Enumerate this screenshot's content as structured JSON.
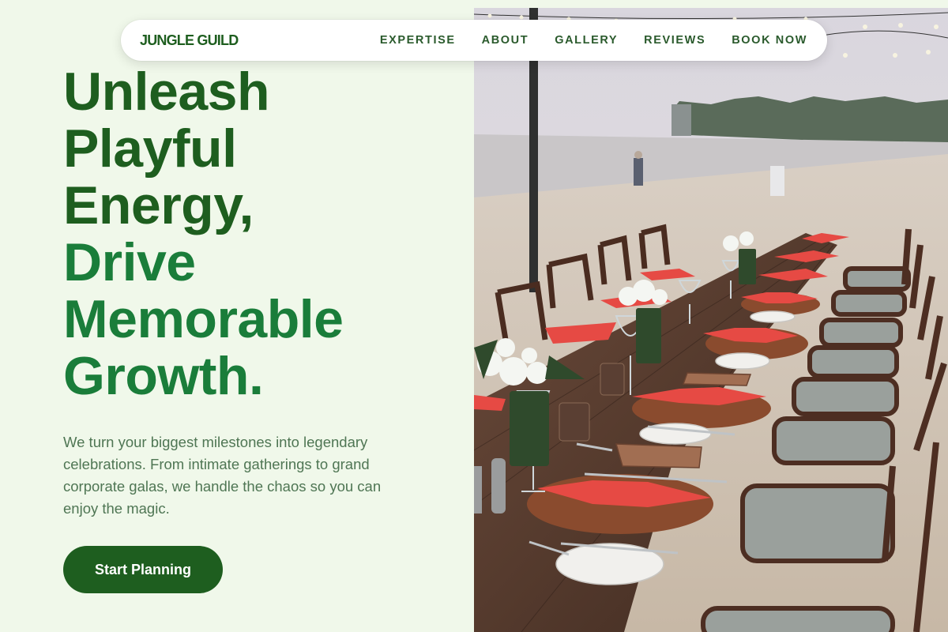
{
  "nav": {
    "brand": "JUNGLE GUILD",
    "links": [
      "EXPERTISE",
      "ABOUT",
      "GALLERY",
      "REVIEWS",
      "BOOK NOW"
    ]
  },
  "hero": {
    "headline_lines": [
      "Unleash",
      "Playful",
      "Energy,",
      "Drive",
      "Memorable",
      "Growth."
    ],
    "description": "We turn your biggest milestones into legendary celebrations. From intimate gatherings to grand corporate galas, we handle the chaos so you can enjoy the magic.",
    "cta_label": "Start Planning"
  },
  "colors": {
    "background": "#f0f8ea",
    "primary_dark_green": "#1e5e1f",
    "accent_green": "#1a7d3a",
    "text_muted": "#4f7654"
  }
}
